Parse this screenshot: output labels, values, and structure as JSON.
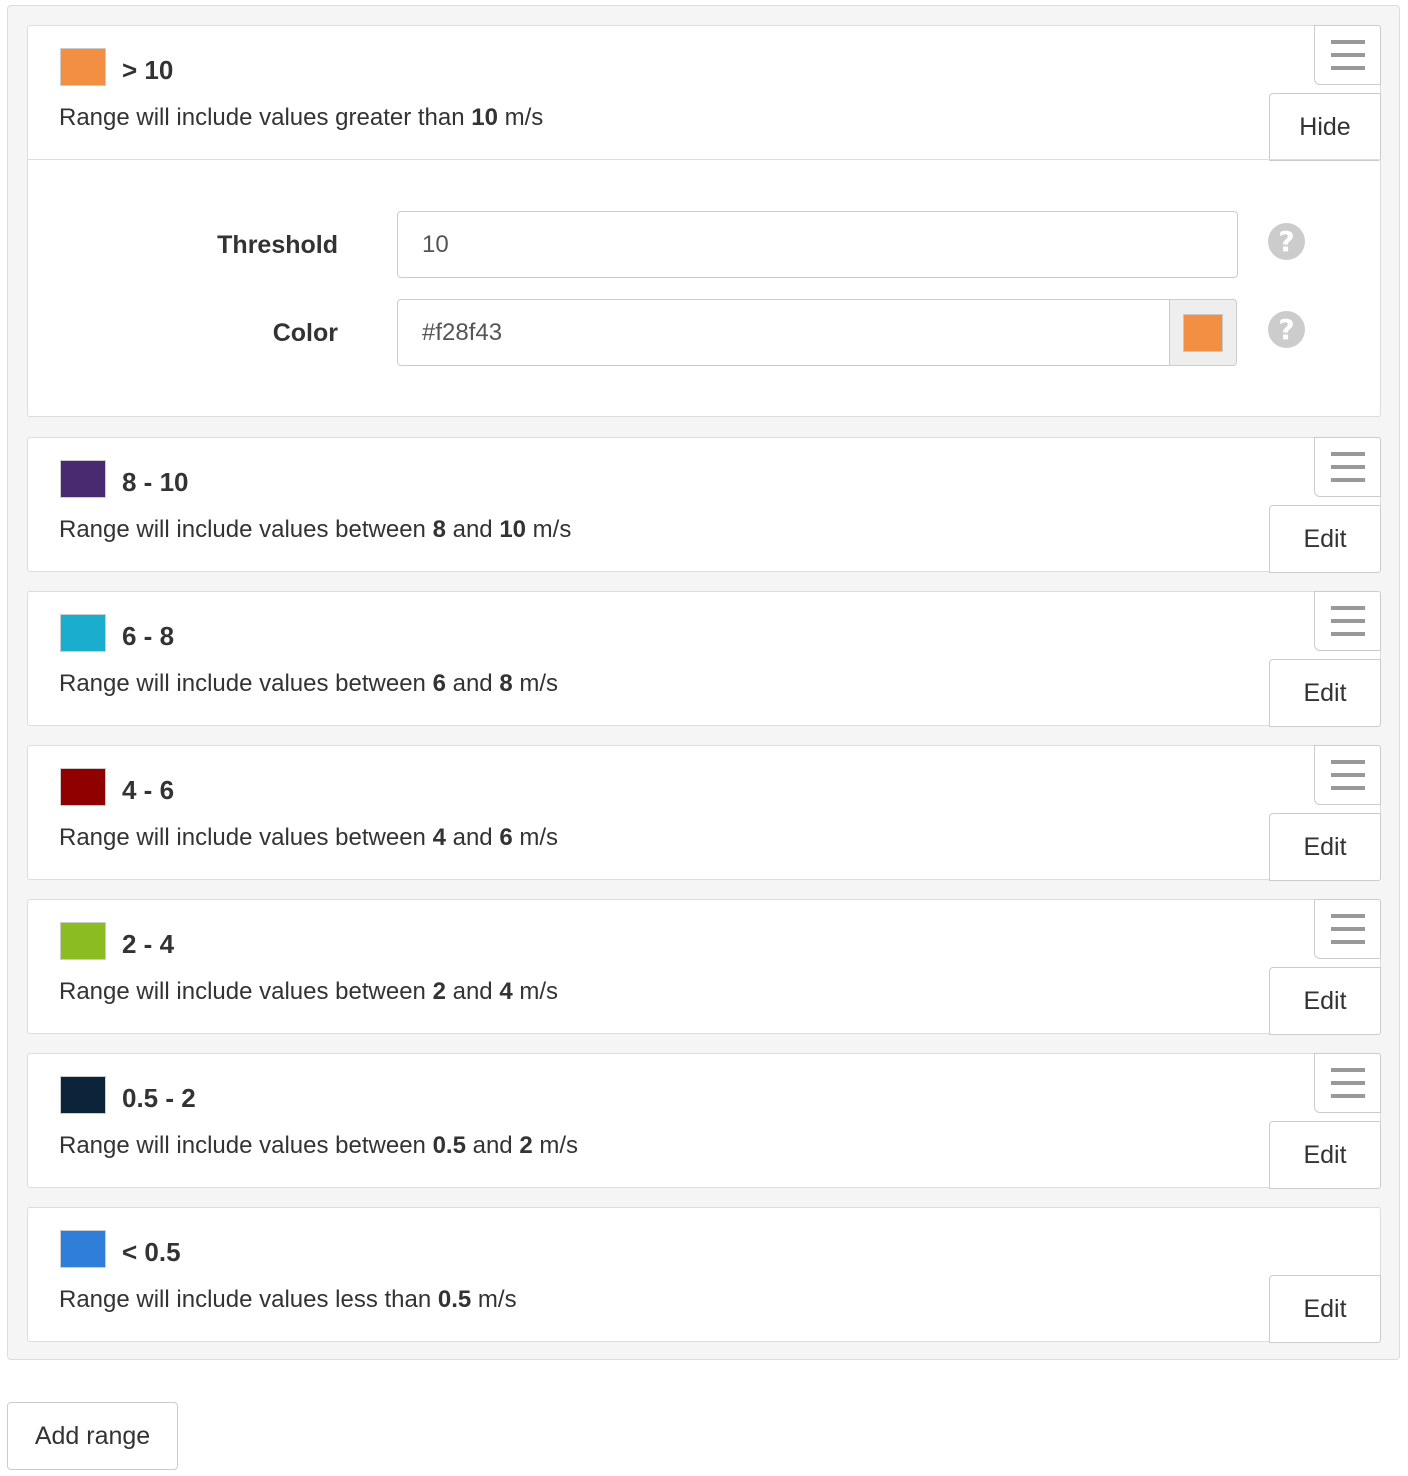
{
  "unit": "m/s",
  "ranges": [
    {
      "title": "> 10",
      "color": "#f28f43",
      "desc_pre": "Range will include values greater than ",
      "v1": "10",
      "desc_post": " m/s",
      "action": "Hide",
      "editor": {
        "threshold_label": "Threshold",
        "threshold_value": "10",
        "color_label": "Color",
        "color_value": "#f28f43",
        "help_glyph": "?"
      }
    },
    {
      "title": "8 - 10",
      "color": "#492970",
      "desc_pre": "Range will include values between ",
      "v1": "8",
      "mid": " and ",
      "v2": "10",
      "desc_post": " m/s",
      "action": "Edit"
    },
    {
      "title": "6 - 8",
      "color": "#1aadce",
      "desc_pre": "Range will include values between ",
      "v1": "6",
      "mid": " and ",
      "v2": "8",
      "desc_post": " m/s",
      "action": "Edit"
    },
    {
      "title": "4 - 6",
      "color": "#910000",
      "desc_pre": "Range will include values between ",
      "v1": "4",
      "mid": " and ",
      "v2": "6",
      "desc_post": " m/s",
      "action": "Edit"
    },
    {
      "title": "2 - 4",
      "color": "#8bbc21",
      "desc_pre": "Range will include values between ",
      "v1": "2",
      "mid": " and ",
      "v2": "4",
      "desc_post": " m/s",
      "action": "Edit"
    },
    {
      "title": "0.5 - 2",
      "color": "#0d233a",
      "desc_pre": "Range will include values between ",
      "v1": "0.5",
      "mid": " and ",
      "v2": "2",
      "desc_post": " m/s",
      "action": "Edit"
    },
    {
      "title": "< 0.5",
      "color": "#2f7ed8",
      "desc_pre": "Range will include values less than ",
      "v1": "0.5",
      "desc_post": " m/s",
      "action": "Edit"
    }
  ],
  "add_button_label": "Add range"
}
